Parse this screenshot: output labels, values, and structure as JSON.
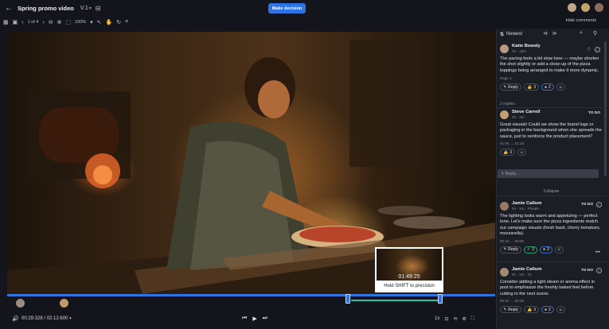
{
  "header": {
    "title": "Spring promo video",
    "version": "V.1",
    "make_decision": "Make decision",
    "hide_comments": "Hide comments"
  },
  "toolbar": {
    "page": "1 of 4",
    "zoom": "100%"
  },
  "preview": {
    "time": "01:49:25",
    "hint": "Hold SHIFT to precision"
  },
  "controls": {
    "timecode": "00:29:328 / 02:12:600",
    "speed": "1x"
  },
  "panel": {
    "sort": "Newest",
    "comments": [
      {
        "name": "Katie Bewsly",
        "meta": "#3 · 15m",
        "body": "The pacing feels a bit slow here — maybe shorten the shot slightly or add a close-up of the pizza toppings being arranged to make it more dynamic.",
        "page": "Page 1",
        "reply": "Reply",
        "reactions": [
          "3",
          "2"
        ]
      },
      {
        "name": "Steve Carrell",
        "meta": "#3 · 2m",
        "status": "TO DO",
        "body": "Great visuals! Could we show the brand logo or packaging in the background when she spreads the sauce, just to reinforce the product placement?",
        "time": "01:05 → 01:25",
        "reactions": [
          "3"
        ]
      },
      {
        "name": "Jamie Callum",
        "meta": "#4 · 1m · Private",
        "status": "TO DO",
        "body": "The lighting looks warm and appetizing — perfect tone. Let's make sure the pizza ingredients match our campaign visuals (fresh basil, cherry tomatoes, mozzarella).",
        "time": "00:34 → 00:50",
        "reply": "Reply",
        "reactions": [
          "2",
          "3"
        ]
      },
      {
        "name": "Jamie Callum",
        "meta": "#1 · 1m · #1",
        "status": "TO DO",
        "body": "Consider adding a light steam or aroma effect in post to emphasize the freshly baked feel before cutting to the next scene.",
        "time": "00:22 → 00:35",
        "reply": "Reply",
        "reactions": [
          "3",
          "2"
        ]
      }
    ],
    "replies_count": "2 replies",
    "reply_placeholder": "Reply...",
    "collapse": "Collapse"
  }
}
